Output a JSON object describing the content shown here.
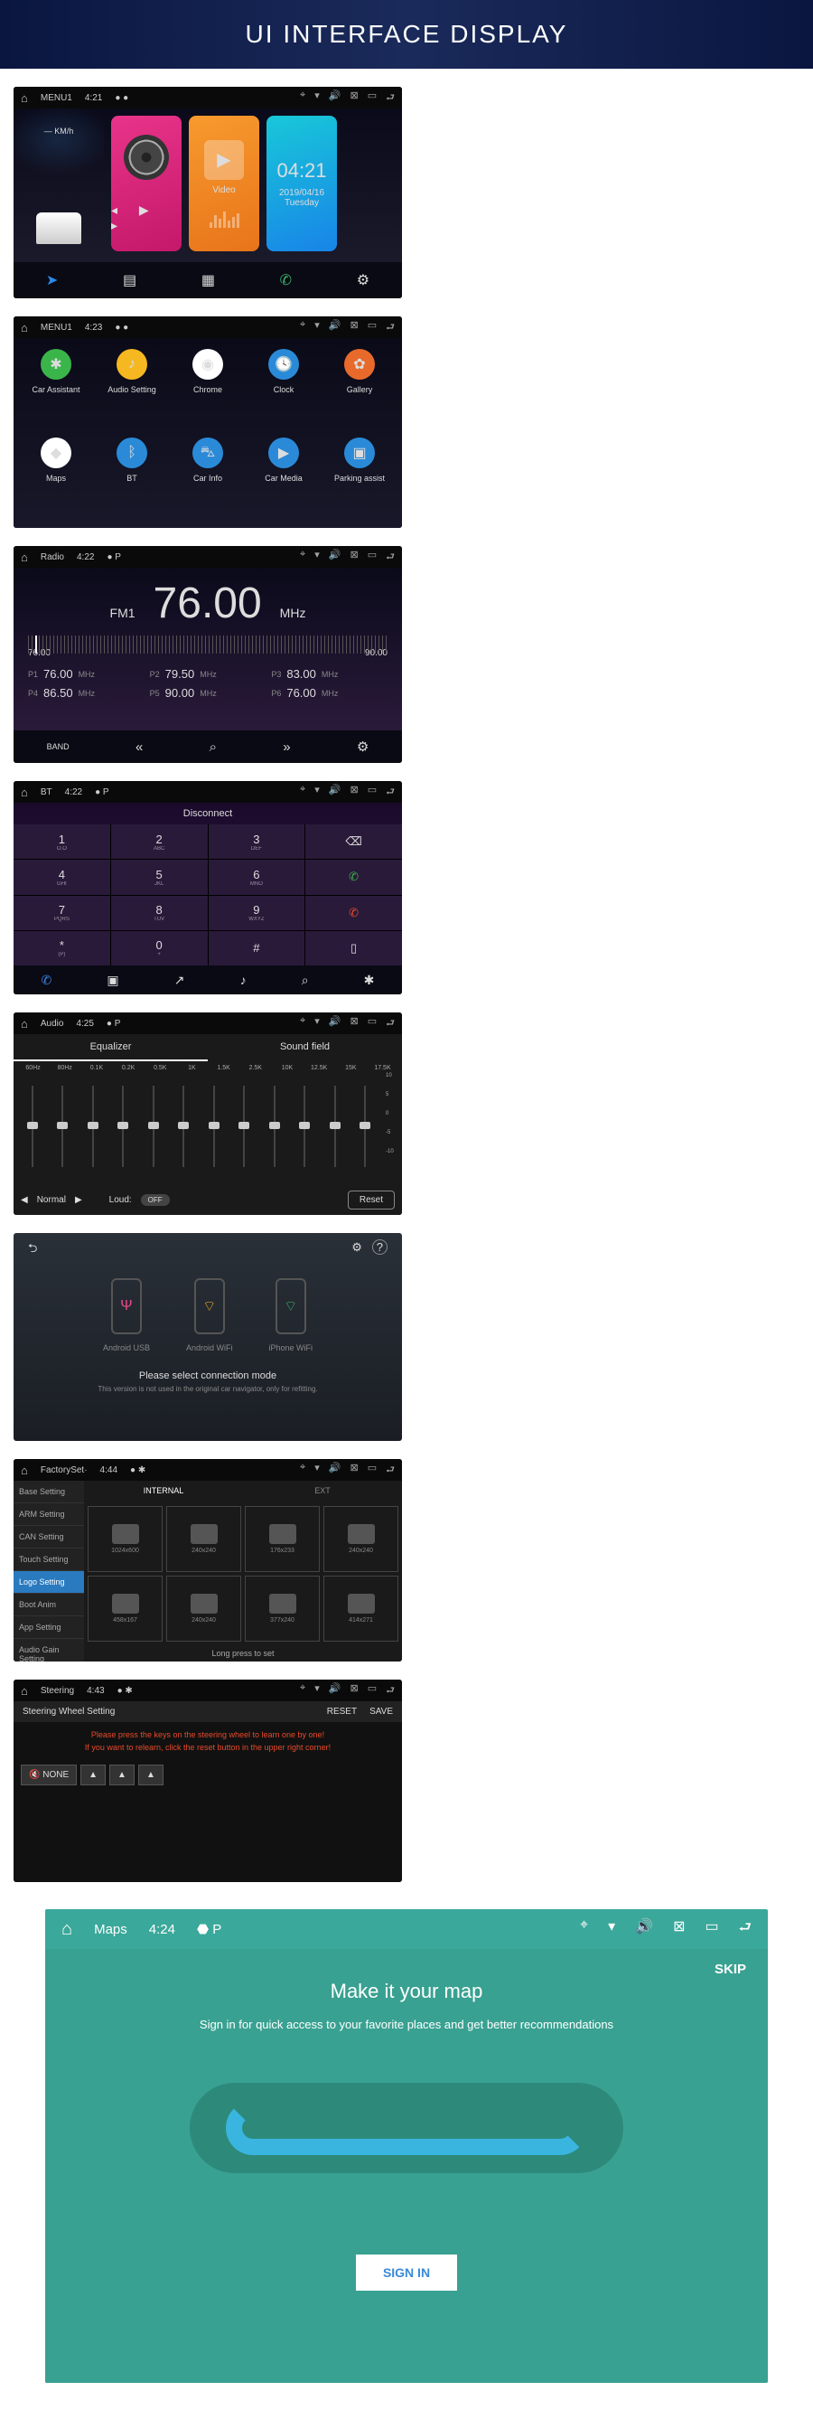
{
  "banner": "UI INTERFACE DISPLAY",
  "status_icons": {
    "loc": "⌖",
    "wifi": "▾",
    "vol": "🔊",
    "close": "⊠",
    "recent": "▭",
    "back": "⮐"
  },
  "s1": {
    "title": "MENU1",
    "time": "4:21",
    "speed_label": "— KM/h",
    "video": "Video",
    "clock_time": "04:21",
    "clock_date": "2019/04/16",
    "clock_day": "Tuesday",
    "dock": {
      "nav": "➤",
      "radio": "▤",
      "apps": "▦",
      "phone": "✆",
      "settings": "⚙"
    }
  },
  "s2": {
    "title": "MENU1",
    "time": "4:23",
    "apps": [
      {
        "label": "Car Assistant",
        "icon": "✱",
        "bg": "#3ab54a"
      },
      {
        "label": "Audio Setting",
        "icon": "♪",
        "bg": "#f5b820"
      },
      {
        "label": "Chrome",
        "icon": "◉",
        "bg": "#fff"
      },
      {
        "label": "Clock",
        "icon": "🕓",
        "bg": "#2a8ad8"
      },
      {
        "label": "Gallery",
        "icon": "✿",
        "bg": "#e86a2a"
      },
      {
        "label": "Maps",
        "icon": "◆",
        "bg": "#fff"
      },
      {
        "label": "BT",
        "icon": "ᛒ",
        "bg": "#2a8ad8"
      },
      {
        "label": "Car Info",
        "icon": "⛍",
        "bg": "#2a8ad8"
      },
      {
        "label": "Car Media",
        "icon": "▶",
        "bg": "#2a8ad8"
      },
      {
        "label": "Parking assist",
        "icon": "▣",
        "bg": "#2a8ad8"
      }
    ]
  },
  "s3": {
    "title": "Radio",
    "time": "4:22",
    "band": "FM1",
    "freq": "76.00",
    "unit": "MHz",
    "range_lo": "76.00",
    "range_hi": "90.00",
    "presets": [
      {
        "n": "P1",
        "v": "76.00",
        "u": "MHz"
      },
      {
        "n": "P2",
        "v": "79.50",
        "u": "MHz"
      },
      {
        "n": "P3",
        "v": "83.00",
        "u": "MHz"
      },
      {
        "n": "P4",
        "v": "86.50",
        "u": "MHz"
      },
      {
        "n": "P5",
        "v": "90.00",
        "u": "MHz"
      },
      {
        "n": "P6",
        "v": "76.00",
        "u": "MHz"
      }
    ],
    "dock": {
      "band": "BAND",
      "prev": "«",
      "search": "⌕",
      "next": "»",
      "settings": "⚙"
    }
  },
  "s4": {
    "title": "BT",
    "time": "4:22",
    "disconnect": "Disconnect",
    "keys": [
      {
        "d": "1",
        "s": "O.O"
      },
      {
        "d": "2",
        "s": "ABC"
      },
      {
        "d": "3",
        "s": "DEF"
      },
      {
        "d": "⌫",
        "s": "",
        "a": true
      },
      {
        "d": "4",
        "s": "GHI"
      },
      {
        "d": "5",
        "s": "JKL"
      },
      {
        "d": "6",
        "s": "MNO"
      },
      {
        "d": "✆",
        "s": "",
        "a": true,
        "c": "#3ab54a"
      },
      {
        "d": "7",
        "s": "PQRS"
      },
      {
        "d": "8",
        "s": "TUV"
      },
      {
        "d": "9",
        "s": "WXYZ"
      },
      {
        "d": "✆",
        "s": "",
        "a": true,
        "c": "#e84a2a"
      },
      {
        "d": "*",
        "s": "(P)"
      },
      {
        "d": "0",
        "s": "+"
      },
      {
        "d": "#",
        "s": ""
      },
      {
        "d": "▯",
        "s": "",
        "a": true
      }
    ],
    "dock": [
      "✆",
      "▣",
      "↗",
      "♪",
      "⌕",
      "✱"
    ]
  },
  "s5": {
    "title": "Audio",
    "time": "4:25",
    "tab_eq": "Equalizer",
    "tab_sf": "Sound field",
    "bands": [
      "60Hz",
      "80Hz",
      "0.1K",
      "0.2K",
      "0.5K",
      "1K",
      "1.5K",
      "2.5K",
      "10K",
      "12.5K",
      "15K",
      "17.5K"
    ],
    "scale": [
      "10",
      "5",
      "0",
      "-5",
      "-10"
    ],
    "foot_prev": "◀",
    "foot_mode": "Normal",
    "foot_next": "▶",
    "foot_loud": "Loud:",
    "foot_toggle": "OFF",
    "foot_reset": "Reset"
  },
  "s6": {
    "back": "⮌",
    "gear": "⚙",
    "help": "?",
    "modes": [
      {
        "label": "Android USB",
        "icon": "Ψ",
        "c": "#e84a8a"
      },
      {
        "label": "Android WiFi",
        "icon": "⌔",
        "c": "#f5b820"
      },
      {
        "label": "iPhone WiFi",
        "icon": "⌔",
        "c": "#3ab56a"
      }
    ],
    "t1": "Please select connection mode",
    "t2": "This version is not used in the original car navigator, only for refitting."
  },
  "s7": {
    "title": "FactorySet·",
    "time": "4:44",
    "side": [
      "Base Setting",
      "ARM Setting",
      "CAN Setting",
      "Touch Setting",
      "Logo Setting",
      "Boot Anim",
      "App Setting",
      "Audio Gain Setting"
    ],
    "side_active": 4,
    "tab_int": "INTERNAL",
    "tab_ext": "EXT",
    "logos": [
      "1024x600",
      "240x240",
      "176x233",
      "240x240",
      "458x167",
      "240x240",
      "377x240",
      "414x271"
    ],
    "hint": "Long press to set"
  },
  "s8": {
    "title": "Steering",
    "time": "4:43",
    "head": "Steering Wheel Setting",
    "reset": "RESET",
    "save": "SAVE",
    "warn1": "Please press the keys on the steering wheel to learn one by one!",
    "warn2": "If you want to relearn, click the reset button in the upper right corner!",
    "btns": [
      "🔇 NONE",
      "▲",
      "▲",
      "▲"
    ]
  },
  "maps": {
    "title": "Maps",
    "time": "4:24",
    "skip": "SKIP",
    "h": "Make it your map",
    "sub": "Sign in for quick access to your favorite places and get better recommendations",
    "btn": "SIGN IN"
  }
}
